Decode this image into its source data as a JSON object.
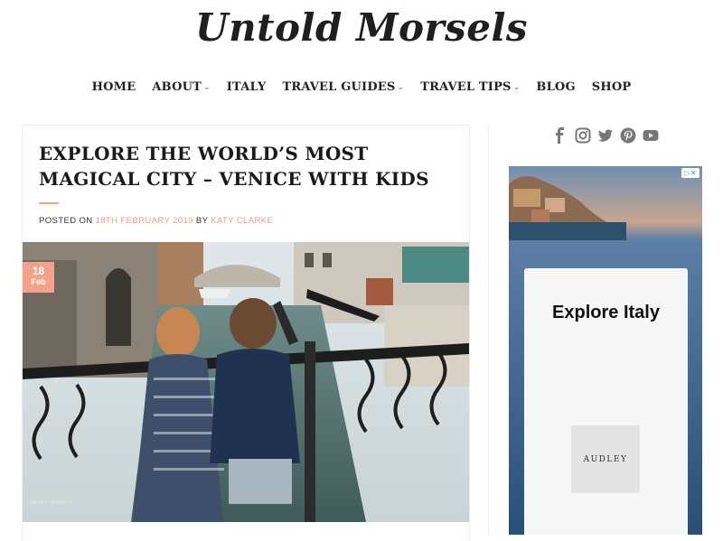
{
  "site": {
    "logo": "Untold Morsels"
  },
  "nav": [
    {
      "label": "HOME",
      "dropdown": false
    },
    {
      "label": "ABOUT",
      "dropdown": true
    },
    {
      "label": "ITALY",
      "dropdown": false
    },
    {
      "label": "TRAVEL GUIDES",
      "dropdown": true
    },
    {
      "label": "TRAVEL TIPS",
      "dropdown": true
    },
    {
      "label": "BLOG",
      "dropdown": false
    },
    {
      "label": "SHOP",
      "dropdown": false
    }
  ],
  "post": {
    "title": "EXPLORE THE WORLD’S MOST MAGICAL CITY – VENICE WITH KIDS",
    "posted_on_label": "POSTED ON",
    "date": "18TH FEBRUARY 2019",
    "by_label": "BY",
    "author": "KATY CLARKE",
    "badge_day": "18",
    "badge_month": "Feb",
    "image_watermark": "UNTOLD MORSELS"
  },
  "sidebar": {
    "social_icons": [
      "facebook-icon",
      "instagram-icon",
      "twitter-icon",
      "pinterest-icon",
      "youtube-icon"
    ],
    "ad": {
      "title": "Explore Italy",
      "brand": "AUDLEY"
    }
  },
  "colors": {
    "accent": "#f2a28b",
    "link": "#f09a84"
  }
}
